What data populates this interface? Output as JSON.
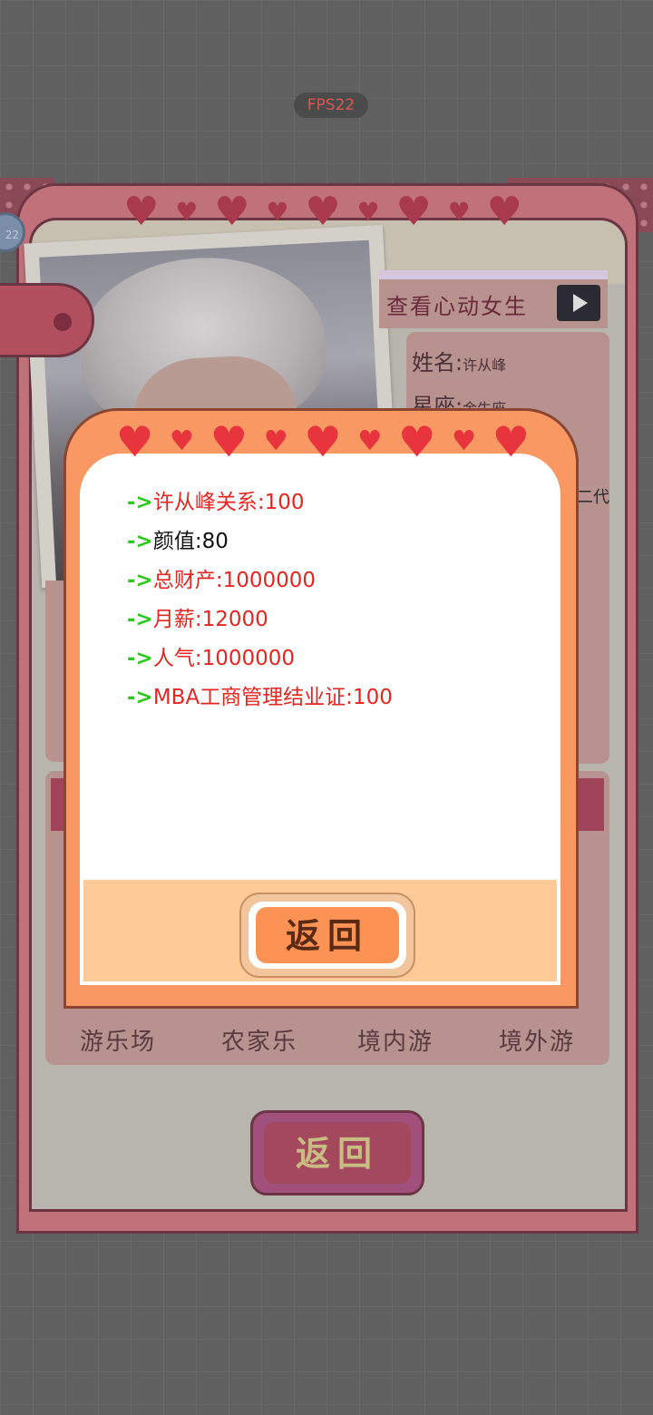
{
  "hud": {
    "fps": "FPS22"
  },
  "side_badge": "22",
  "profile_card": {
    "view_heart_girls": "查看心动女生",
    "name_label": "姓名",
    "name_value": "许从峰",
    "sign_label": "星座",
    "sign_value": "金牛座",
    "cut_text": "二代",
    "destinations": [
      "游乐场",
      "农家乐",
      "境内游",
      "境外游"
    ],
    "return_label": "返回"
  },
  "modal": {
    "stats": [
      {
        "text": "许从峰关系:100",
        "color": "red"
      },
      {
        "text": "颜值:80",
        "color": "black"
      },
      {
        "text": "总财产:1000000",
        "color": "red"
      },
      {
        "text": "月薪:12000",
        "color": "red"
      },
      {
        "text": "人气:1000000",
        "color": "red"
      },
      {
        "text": "MBA工商管理结业证:100",
        "color": "red"
      }
    ],
    "arrow_glyph": "->",
    "return_label": "返回"
  },
  "colors": {
    "background": "#5f605f",
    "card": "#c0717a",
    "modal_frame": "#f99863",
    "stat_red": "#e42621",
    "arrow_green": "#2fc81f",
    "heart_red": "#e8343c"
  },
  "icons": [
    "heart-icon",
    "play-video-icon"
  ]
}
